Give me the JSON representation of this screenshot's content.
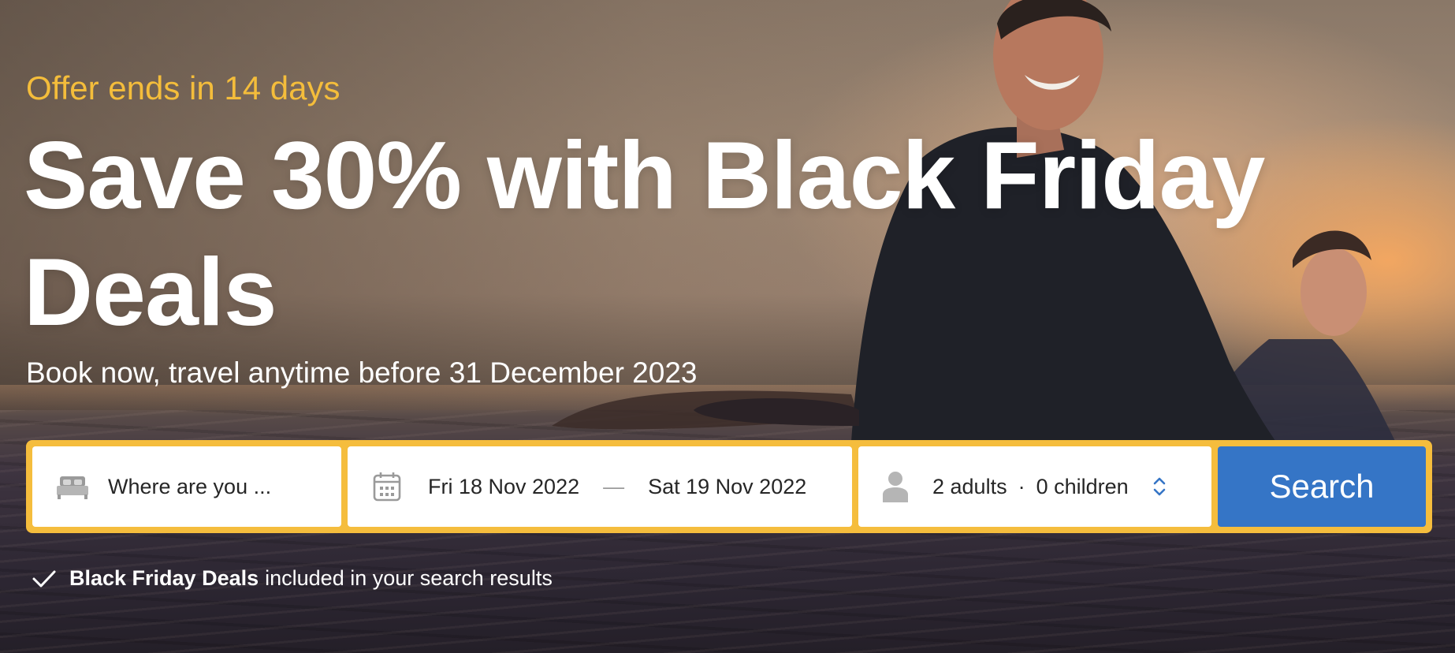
{
  "hero": {
    "offer_text": "Offer ends in 14 days",
    "headline": "Save 30% with Black Friday Deals",
    "subhead": "Book now, travel anytime before 31 December 2023"
  },
  "search": {
    "destination_placeholder": "Where are you ...",
    "check_in": "Fri 18 Nov 2022",
    "date_separator": "—",
    "check_out": "Sat 19 Nov 2022",
    "adults": "2 adults",
    "guests_separator": "·",
    "children": "0 children",
    "button_label": "Search"
  },
  "note": {
    "bold": "Black Friday Deals",
    "rest": "included in your search results"
  },
  "icons": {
    "destination": "bed-icon",
    "dates": "calendar-icon",
    "guests": "person-icon",
    "guests_stepper": "up-down-chevron-icon",
    "note": "checkmark-icon"
  },
  "colors": {
    "offer_text": "#f4bd3b",
    "searchbar_border": "#f5bd3d",
    "search_button": "#3575c6",
    "stepper_chevron": "#3575c6"
  }
}
